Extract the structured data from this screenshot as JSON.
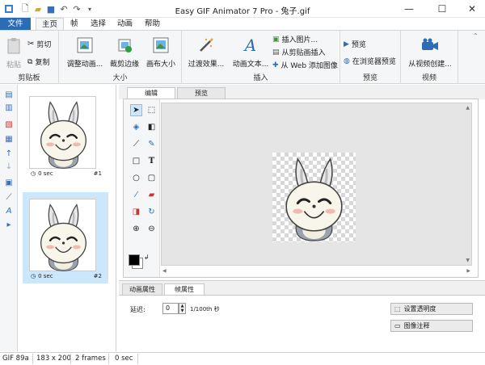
{
  "window": {
    "title": "Easy GIF Animator 7 Pro - 兔子.gif"
  },
  "quick_access": [
    "new-file-icon",
    "open-folder-icon",
    "save-icon",
    "undo-icon",
    "redo-icon",
    "dropdown-icon"
  ],
  "tabs": [
    "文件",
    "主页",
    "帧",
    "选择",
    "动画",
    "帮助"
  ],
  "ribbon": {
    "clipboard": {
      "label": "剪贴板",
      "paste": "粘贴",
      "cut": "剪切",
      "copy": "复制"
    },
    "size": {
      "label": "大小",
      "resize": "调整动画...",
      "crop": "裁剪边缘",
      "canvas": "画布大小"
    },
    "insert": {
      "label": "插入",
      "transition": "过渡效果...",
      "animtext": "动画文本...",
      "insert_picture": "插入图片...",
      "insert_clipboard": "从剪贴画插入",
      "insert_web": "从 Web 添加图像"
    },
    "preview": {
      "label": "预览",
      "preview": "预览",
      "browser": "在浏览器预览"
    },
    "video": {
      "label": "视频",
      "from_video": "从视频创建..."
    }
  },
  "frames": [
    {
      "delay": "0 sec",
      "number": "#1",
      "selected": false
    },
    {
      "delay": "0 sec",
      "number": "#2",
      "selected": true
    }
  ],
  "editor_tabs": [
    "编辑",
    "预览"
  ],
  "property_tabs": [
    "动画属性",
    "帧属性"
  ],
  "frame_props": {
    "delay_label": "延迟:",
    "delay_value": "0",
    "delay_unit": "1/100th 秒",
    "btn_transparency": "设置透明度",
    "btn_comment": "图像注释"
  },
  "status": {
    "format": "GIF 89a",
    "size": "183 x 200",
    "frames": "2 frames",
    "duration": "0 sec"
  },
  "colors": {
    "accent": "#2b6cb4",
    "selected_frame": "#cce6fb",
    "foreground": "#000000",
    "background": "#ffffff"
  }
}
